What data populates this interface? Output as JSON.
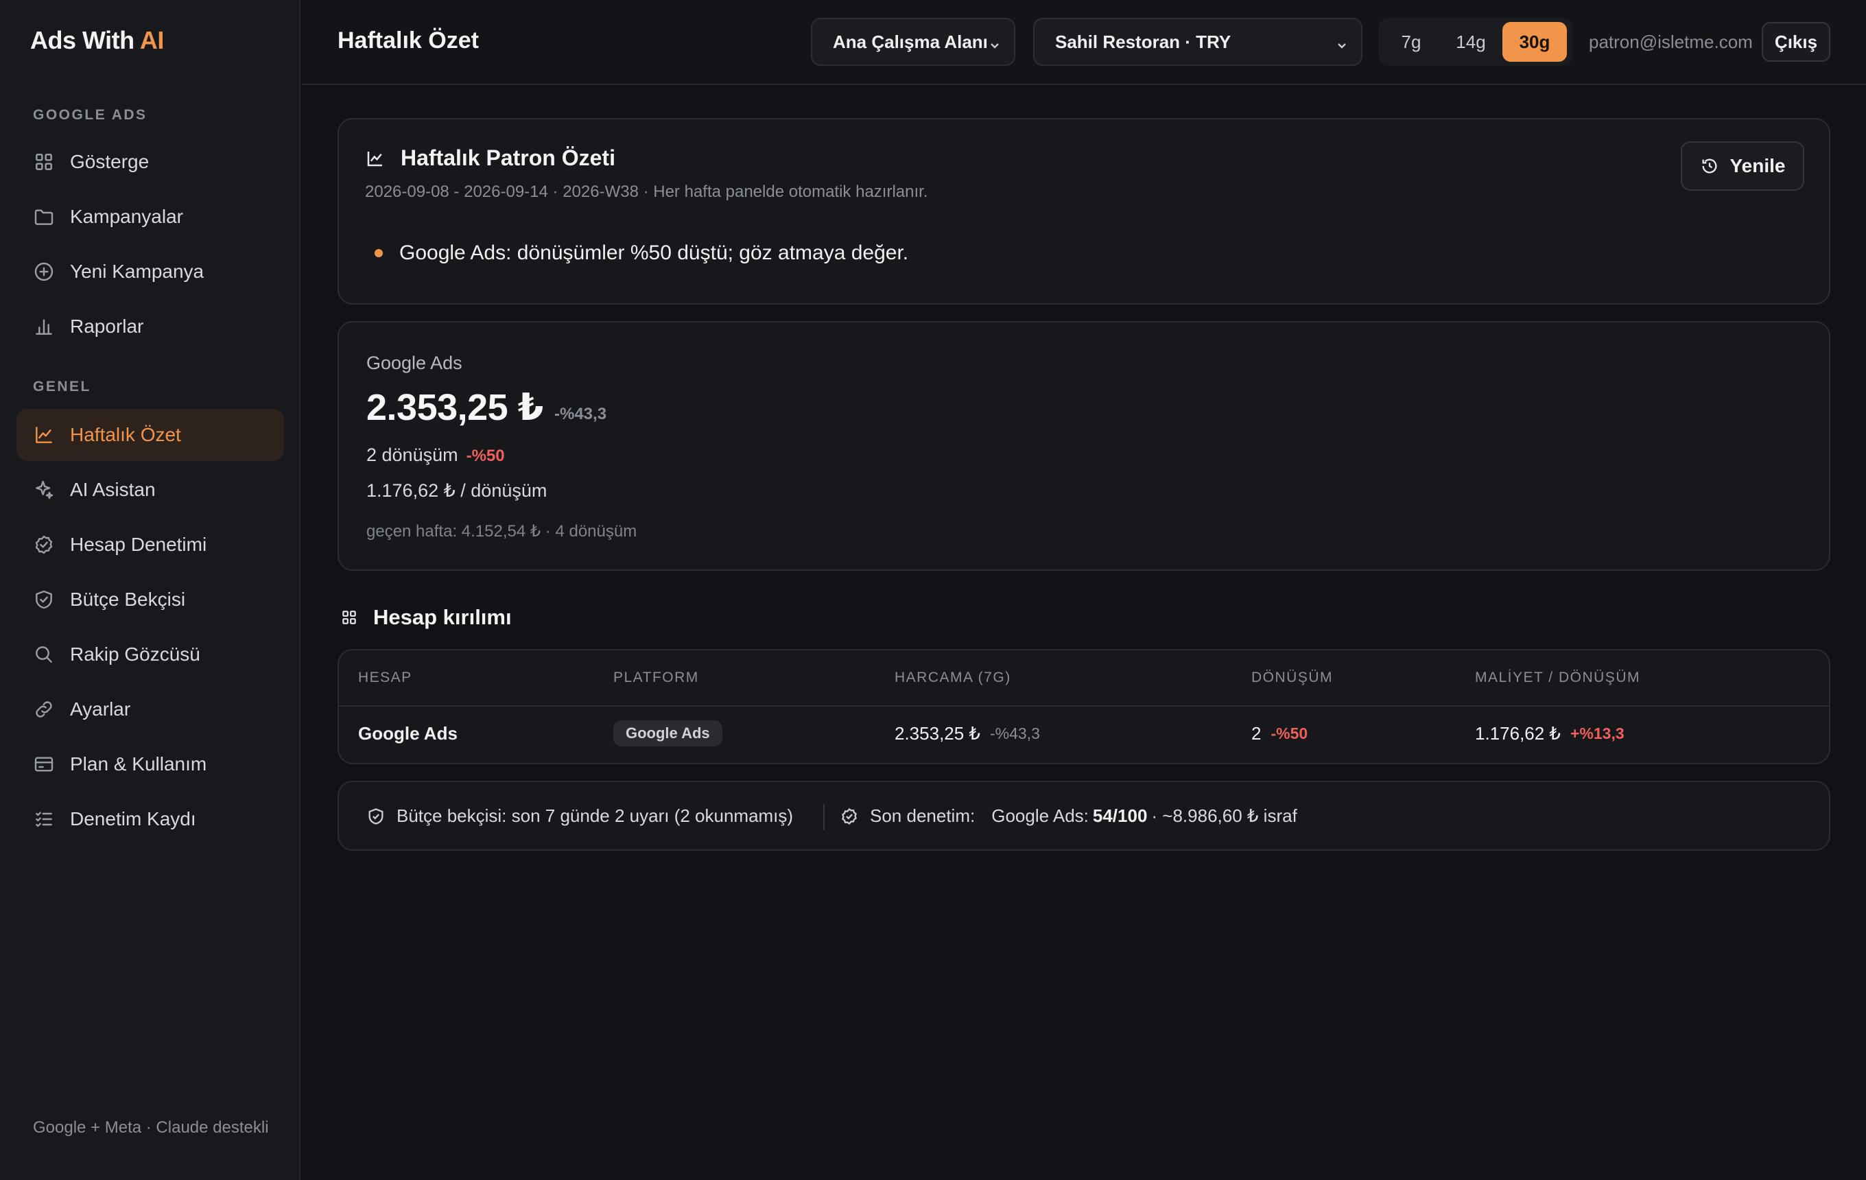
{
  "brand": {
    "name": "Ads With",
    "accent": "AI"
  },
  "sidebar": {
    "sections": [
      {
        "label": "GOOGLE ADS"
      },
      {
        "label": "GENEL"
      }
    ],
    "items": [
      {
        "label": "Gösterge",
        "icon": "grid-icon"
      },
      {
        "label": "Kampanyalar",
        "icon": "folder-icon"
      },
      {
        "label": "Yeni Kampanya",
        "icon": "plus-circle-icon"
      },
      {
        "label": "Raporlar",
        "icon": "bar-chart-icon"
      },
      {
        "label": "Haftalık Özet",
        "icon": "trend-chart-icon",
        "active": true
      },
      {
        "label": "AI Asistan",
        "icon": "sparkles-icon"
      },
      {
        "label": "Hesap Denetimi",
        "icon": "badge-check-icon"
      },
      {
        "label": "Bütçe Bekçisi",
        "icon": "shield-check-icon"
      },
      {
        "label": "Rakip Gözcüsü",
        "icon": "search-icon"
      },
      {
        "label": "Ayarlar",
        "icon": "link-icon"
      },
      {
        "label": "Plan & Kullanım",
        "icon": "credit-card-icon"
      },
      {
        "label": "Denetim Kaydı",
        "icon": "list-checks-icon"
      }
    ],
    "footer": "Google + Meta · Claude destekli"
  },
  "header": {
    "title": "Haftalık Özet",
    "workspace": "Ana Çalışma Alanı",
    "account": "Sahil Restoran · TRY",
    "ranges": [
      "7g",
      "14g",
      "30g"
    ],
    "active_range": "30g",
    "email": "patron@isletme.com",
    "logout": "Çıkış"
  },
  "summary": {
    "title": "Haftalık Patron Özeti",
    "meta": "2026-09-08 - 2026-09-14 · 2026-W38 · Her hafta panelde otomatik hazırlanır.",
    "bullets": [
      "Google Ads: dönüşümler %50 düştü; göz atmaya değer."
    ],
    "refresh_label": "Yenile"
  },
  "stats": {
    "platform": "Google Ads",
    "spend": "2.353,25 ₺",
    "spend_delta": "-%43,3",
    "conversions": "2 dönüşüm",
    "conversions_delta": "-%50",
    "cpa": "1.176,62 ₺ / dönüşüm",
    "previous": "geçen hafta: 4.152,54 ₺ · 4 dönüşüm"
  },
  "breakdown": {
    "title": "Hesap kırılımı",
    "columns": [
      "HESAP",
      "PLATFORM",
      "HARCAMA (7G)",
      "DÖNÜŞÜM",
      "MALİYET / DÖNÜŞÜM"
    ],
    "rows": [
      {
        "account": "Google Ads",
        "platform": "Google Ads",
        "spend": "2.353,25 ₺",
        "spend_delta": "-%43,3",
        "conversions": "2",
        "conversions_delta": "-%50",
        "cpa": "1.176,62 ₺",
        "cpa_delta": "+%13,3"
      }
    ]
  },
  "footer_bar": {
    "budget": "Bütçe bekçisi: son 7 günde 2 uyarı (2 okunmamış)",
    "audit_label": "Son denetim:",
    "audit_platform": "Google Ads:",
    "audit_score": "54/100",
    "audit_waste": "· ~8.986,60 ₺ israf"
  },
  "colors": {
    "accent": "#f0954a",
    "negative": "#f0605a",
    "background": "#111215"
  }
}
